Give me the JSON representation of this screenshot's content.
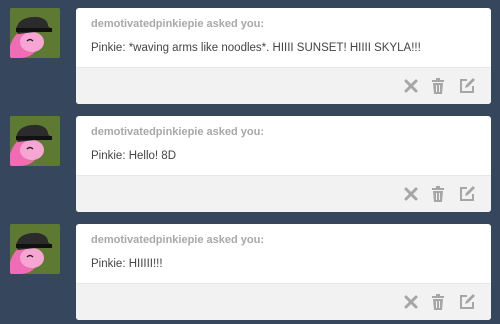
{
  "colors": {
    "background": "#36465d",
    "card": "#ffffff",
    "footer": "#f2f2f2",
    "icon": "#a6a6a6"
  },
  "icons": [
    "avatar-image",
    "close-icon",
    "trash-icon",
    "edit-icon"
  ],
  "asks": [
    {
      "asker_line": "demotivatedpinkiepie asked you:",
      "message": "Pinkie: *waving arms like noodles*. HIIII SUNSET! HIIII SKYLA!!!"
    },
    {
      "asker_line": "demotivatedpinkiepie asked you:",
      "message": "Pinkie: Hello! 8D"
    },
    {
      "asker_line": "demotivatedpinkiepie asked you:",
      "message": "Pinkie: HIIIII!!!"
    }
  ]
}
